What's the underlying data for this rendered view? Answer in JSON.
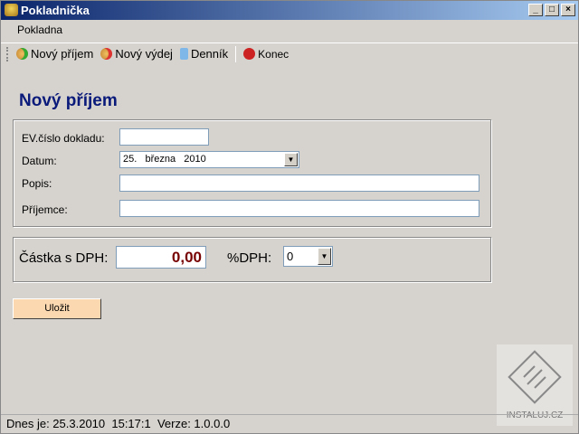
{
  "window": {
    "title": "Pokladnička",
    "min": "_",
    "max": "□",
    "close": "×"
  },
  "menu": {
    "items": [
      "Pokladna"
    ]
  },
  "toolbar": {
    "items": [
      {
        "label": "Nový příjem",
        "icon": "add-icon"
      },
      {
        "label": "Nový výdej",
        "icon": "remove-icon"
      },
      {
        "label": "Denník",
        "icon": "book-icon"
      },
      {
        "label": "Konec",
        "icon": "power-icon"
      }
    ]
  },
  "form": {
    "heading": "Nový příjem",
    "ev_label": "EV.číslo dokladu:",
    "ev_value": "",
    "date_label": "Datum:",
    "date_value": "25.   března   2010",
    "popis_label": "Popis:",
    "popis_value": "",
    "prijemce_label": "Příjemce:",
    "prijemce_value": "",
    "amount_label": "Částka s DPH:",
    "amount_value": "0,00",
    "vat_label": "%DPH:",
    "vat_value": "0",
    "save_label": "Uložit"
  },
  "status": {
    "text": "Dnes je: 25.3.2010  15:17:1  Verze: 1.0.0.0"
  },
  "watermark": "INSTALUJ.CZ"
}
